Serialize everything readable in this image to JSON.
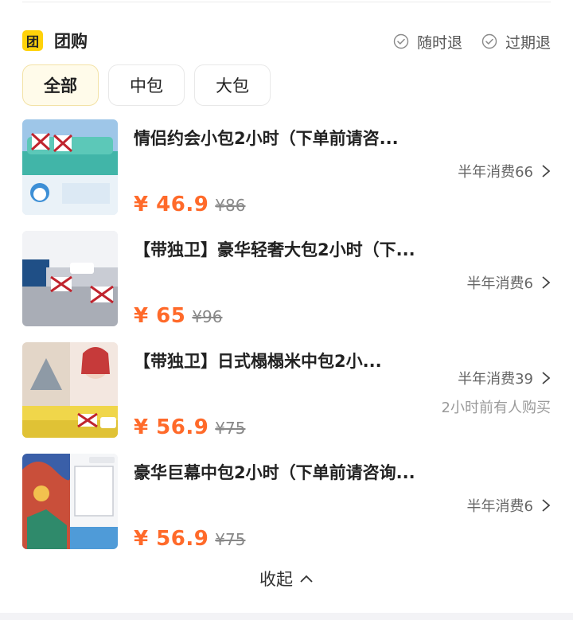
{
  "header": {
    "icon_char": "团",
    "title": "团购",
    "guarantees": [
      "随时退",
      "过期退"
    ]
  },
  "tabs": [
    {
      "label": "全部",
      "active": true
    },
    {
      "label": "中包",
      "active": false
    },
    {
      "label": "大包",
      "active": false
    }
  ],
  "deals": [
    {
      "title": "情侣约会小包2小时（下单前请咨...",
      "sales": "半年消费66",
      "recent": "",
      "price": "¥ 46.9",
      "original_price": "¥86"
    },
    {
      "title": "【带独卫】豪华轻奢大包2小时（下...",
      "sales": "半年消费6",
      "recent": "",
      "price": "¥ 65",
      "original_price": "¥96"
    },
    {
      "title": "【带独卫】日式榻榻米中包2小...",
      "sales": "半年消费39",
      "recent": "2小时前有人购买",
      "price": "¥ 56.9",
      "original_price": "¥75"
    },
    {
      "title": "豪华巨幕中包2小时（下单前请咨询...",
      "sales": "半年消费6",
      "recent": "",
      "price": "¥ 56.9",
      "original_price": "¥75"
    }
  ],
  "footer": {
    "collapse_label": "收起"
  },
  "colors": {
    "accent_yellow": "#ffd20a",
    "price_orange": "#ff6a2a",
    "tab_active_bg": "#fffbea"
  }
}
